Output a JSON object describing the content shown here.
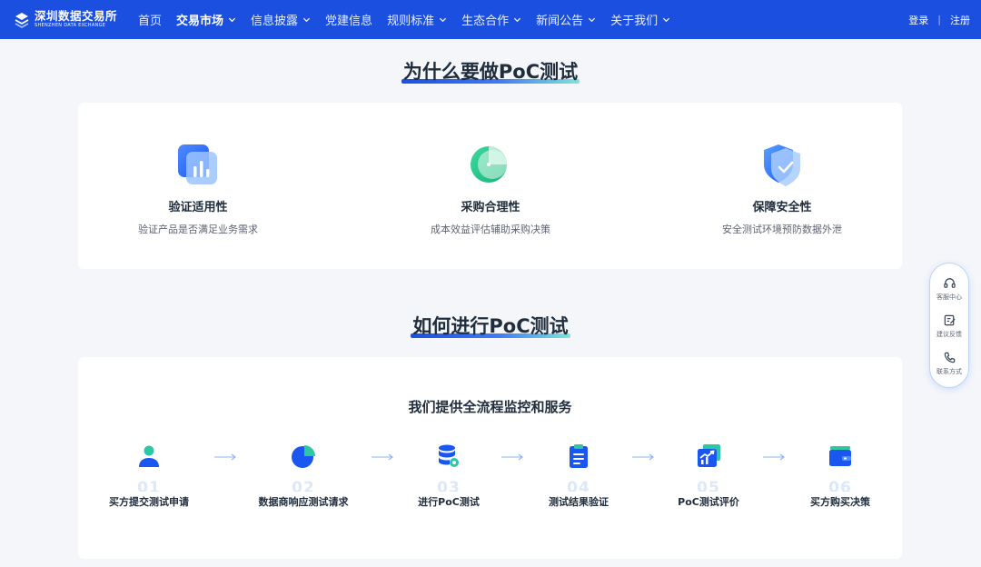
{
  "header": {
    "logo": {
      "cn": "深圳数据交易所",
      "en": "SHENZHEN DATA EXCHANGE"
    },
    "nav": [
      {
        "label": "首页",
        "has_dropdown": false,
        "active": false
      },
      {
        "label": "交易市场",
        "has_dropdown": true,
        "active": true
      },
      {
        "label": "信息披露",
        "has_dropdown": true,
        "active": false
      },
      {
        "label": "党建信息",
        "has_dropdown": false,
        "active": false
      },
      {
        "label": "规则标准",
        "has_dropdown": true,
        "active": false
      },
      {
        "label": "生态合作",
        "has_dropdown": true,
        "active": false
      },
      {
        "label": "新闻公告",
        "has_dropdown": true,
        "active": false
      },
      {
        "label": "关于我们",
        "has_dropdown": true,
        "active": false
      }
    ],
    "login": "登录",
    "separator": "|",
    "register": "注册"
  },
  "why_section": {
    "title": "为什么要做PoC测试",
    "items": [
      {
        "title": "验证适用性",
        "desc": "验证产品是否满足业务需求",
        "icon": "bar-chart-icon"
      },
      {
        "title": "采购合理性",
        "desc": "成本效益评估辅助采购决策",
        "icon": "pie-chart-icon"
      },
      {
        "title": "保障安全性",
        "desc": "安全测试环境预防数据外泄",
        "icon": "shield-check-icon"
      }
    ]
  },
  "how_section": {
    "title": "如何进行PoC测试",
    "subtitle": "我们提供全流程监控和服务",
    "steps": [
      {
        "num": "01",
        "label": "买方提交测试申请",
        "icon": "user-icon"
      },
      {
        "num": "02",
        "label": "数据商响应测试请求",
        "icon": "pie-icon"
      },
      {
        "num": "03",
        "label": "进行PoC测试",
        "icon": "database-icon"
      },
      {
        "num": "04",
        "label": "测试结果验证",
        "icon": "clipboard-icon"
      },
      {
        "num": "05",
        "label": "PoC测试评价",
        "icon": "growth-chart-icon"
      },
      {
        "num": "06",
        "label": "买方购买决策",
        "icon": "wallet-icon"
      }
    ]
  },
  "float_bar": {
    "items": [
      {
        "label": "客服中心",
        "icon": "headset-icon"
      },
      {
        "label": "建议反馈",
        "icon": "edit-icon"
      },
      {
        "label": "联系方式",
        "icon": "phone-icon"
      }
    ]
  },
  "colors": {
    "brand": "#1a4fe0",
    "accent_teal": "#2ec7a4",
    "text_dark": "#1f2d3d",
    "text_muted": "#5b6472",
    "page_bg": "#f4f6fa"
  }
}
